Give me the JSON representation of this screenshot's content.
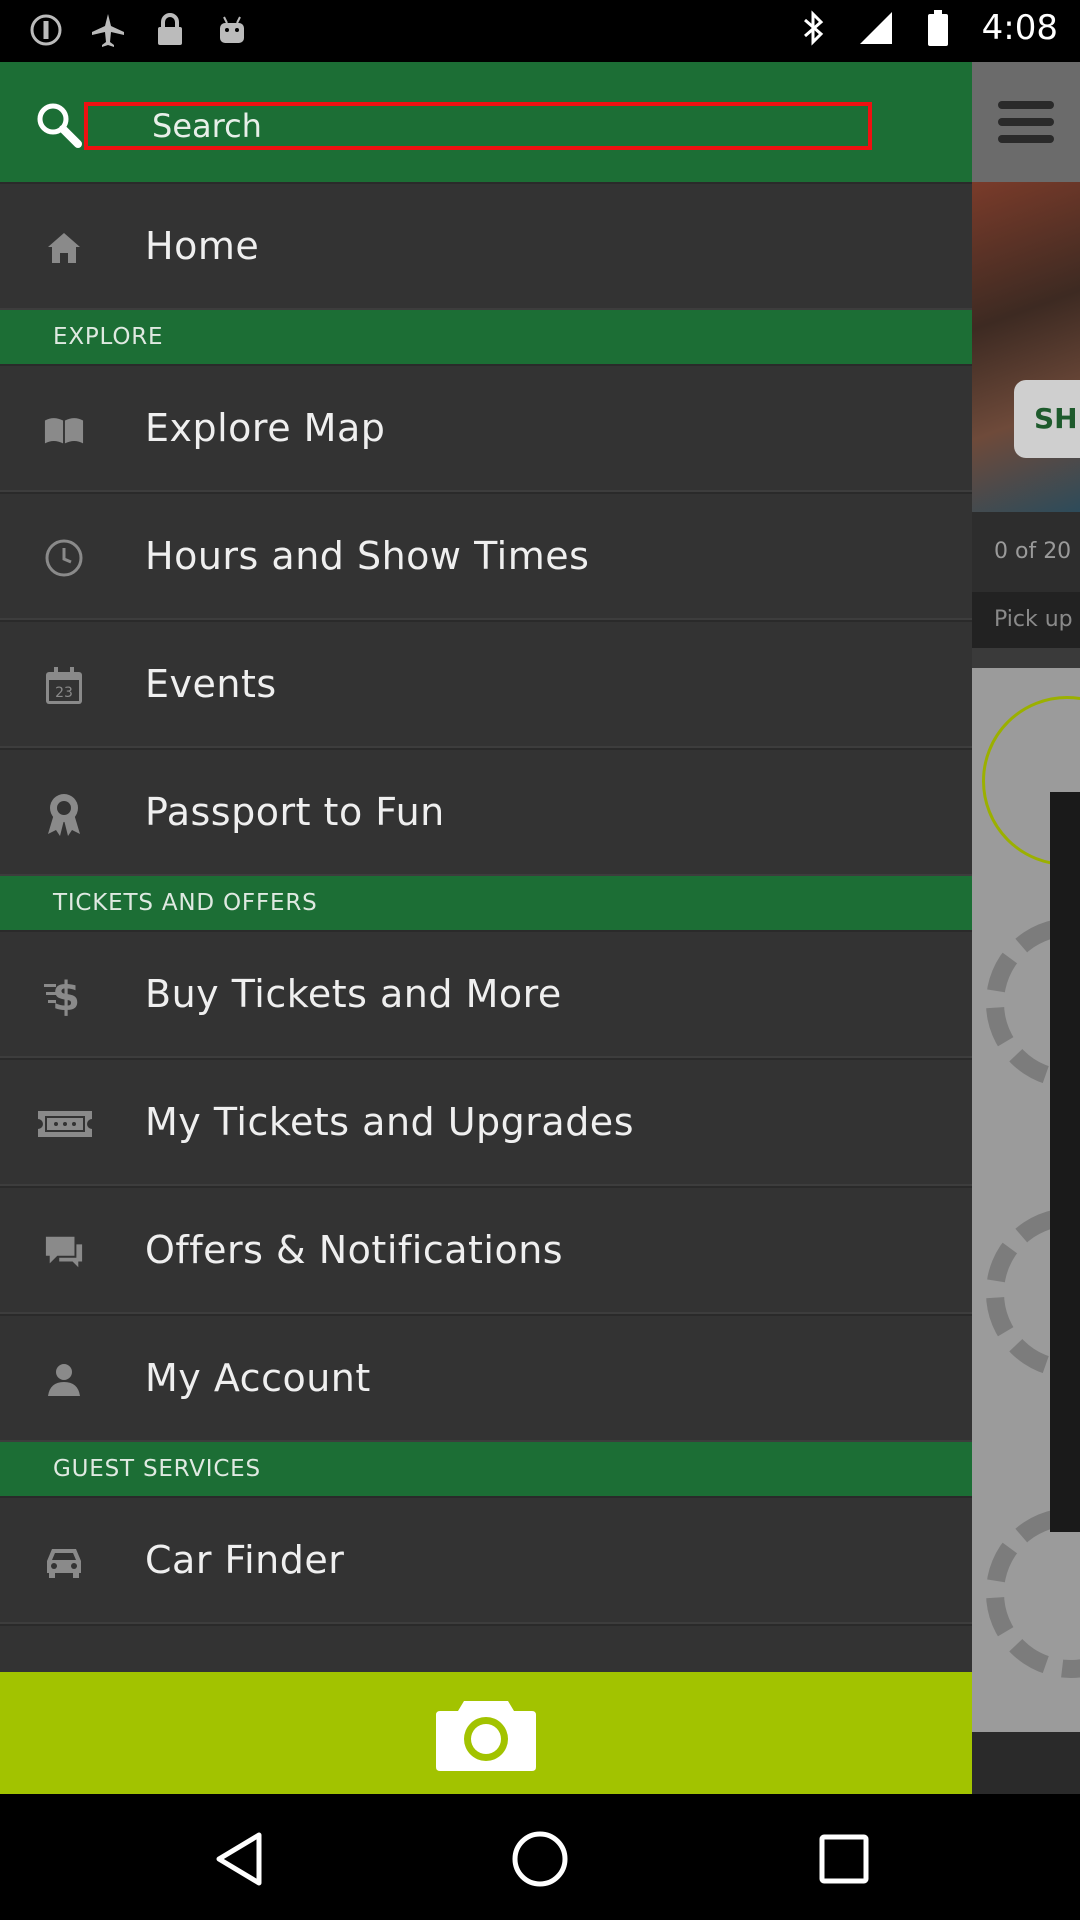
{
  "status_bar": {
    "time": "4:08",
    "left_icons": [
      "info-circle-icon",
      "airplane-icon",
      "lock-icon",
      "android-icon"
    ],
    "right_icons": [
      "bluetooth-icon",
      "signal-icon",
      "battery-icon"
    ]
  },
  "search": {
    "placeholder": "Search"
  },
  "menu": {
    "home": {
      "label": "Home",
      "icon": "home-icon"
    },
    "sections": {
      "explore": "EXPLORE",
      "tickets_offers": "TICKETS AND OFFERS",
      "guest_services": "GUEST SERVICES"
    },
    "explore_items": [
      {
        "label": "Explore Map",
        "icon": "map-icon"
      },
      {
        "label": "Hours and Show Times",
        "icon": "clock-icon"
      },
      {
        "label": "Events",
        "icon": "calendar-icon"
      },
      {
        "label": "Passport to Fun",
        "icon": "ribbon-icon"
      }
    ],
    "tickets_items": [
      {
        "label": "Buy Tickets and More",
        "icon": "dollar-icon"
      },
      {
        "label": "My Tickets and Upgrades",
        "icon": "ticket-icon"
      },
      {
        "label": "Offers & Notifications",
        "icon": "chat-icon"
      },
      {
        "label": "My Account",
        "icon": "person-icon"
      }
    ],
    "guest_items": [
      {
        "label": "Car Finder",
        "icon": "car-icon"
      }
    ]
  },
  "background": {
    "button_text": "SH",
    "count_text": "0 of 20",
    "pick_text": "Pick up"
  },
  "colors": {
    "header_green": "#1c6e35",
    "drawer_bg": "#333333",
    "camera_bar": "#a2c300",
    "search_outline": "#ee1111"
  }
}
